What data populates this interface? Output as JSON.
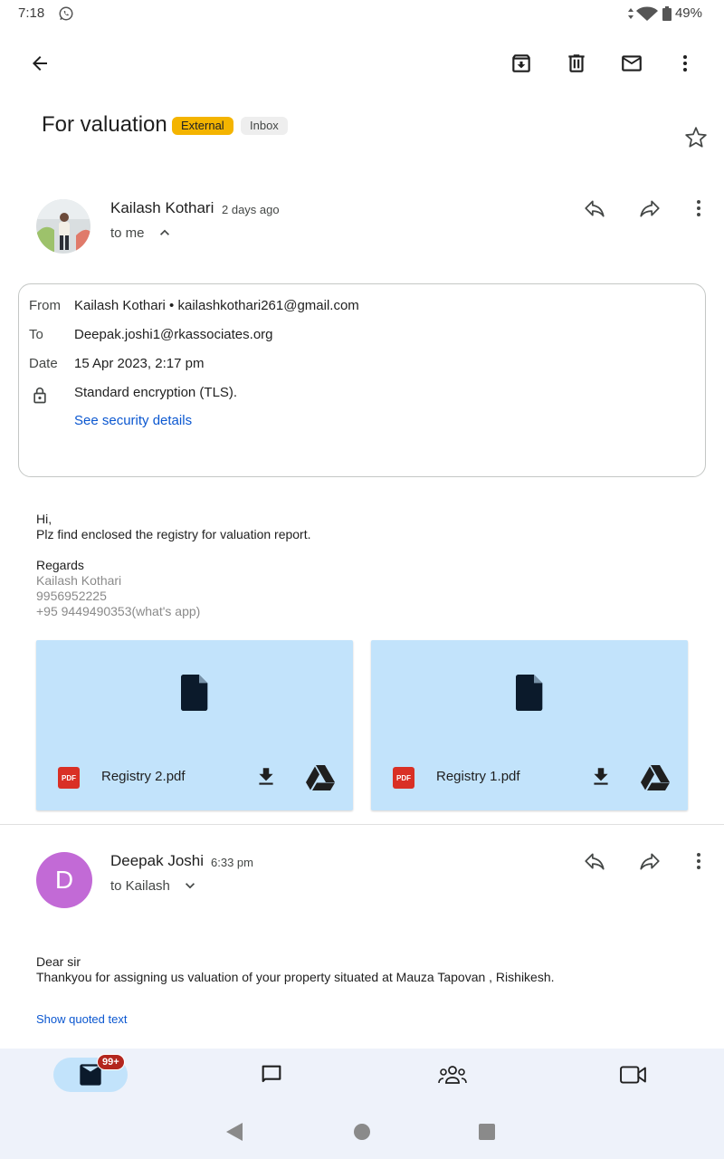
{
  "status_bar": {
    "time": "7:18",
    "battery": "49%"
  },
  "toolbar": {
    "back_icon": "arrow-left",
    "actions": [
      "archive-icon",
      "delete-icon",
      "mark-unread-icon",
      "more-vert-icon"
    ]
  },
  "subject": "For valuation",
  "labels": {
    "external": "External",
    "inbox": "Inbox"
  },
  "message1": {
    "sender": "Kailash Kothari",
    "time": "2 days ago",
    "to": "to me",
    "details": {
      "from_label": "From",
      "from_value": "Kailash Kothari • kailashkothari261@gmail.com",
      "to_label": "To",
      "to_value": "Deepak.joshi1@rkassociates.org",
      "date_label": "Date",
      "date_value": "15 Apr 2023, 2:17 pm",
      "encryption": "Standard encryption (TLS).",
      "security_link": "See security details"
    },
    "body": {
      "greeting": "Hi,",
      "line1": "Plz find enclosed the registry for valuation report.",
      "regards": "Regards",
      "sig_name": "Kailash Kothari",
      "sig_phone1": "9956952225",
      "sig_phone2": "+95 9449490353(what's app)"
    },
    "attachments": [
      {
        "name": "Registry 2.pdf",
        "type": "PDF"
      },
      {
        "name": "Registry 1.pdf",
        "type": "PDF"
      }
    ]
  },
  "message2": {
    "sender": "Deepak Joshi",
    "avatar_letter": "D",
    "time": "6:33 pm",
    "to": "to Kailash",
    "body": {
      "line1": "Dear sir",
      "line2": "Thankyou for assigning us valuation of your property situated at Mauza Tapovan , Rishikesh."
    },
    "show_quoted": "Show quoted text"
  },
  "bottom_nav": {
    "badge": "99+",
    "items": [
      "mail-icon",
      "chat-icon",
      "spaces-icon",
      "meet-icon"
    ]
  },
  "colors": {
    "accent": "#0b57d0",
    "external_chip": "#f4b400",
    "attachment_bg": "#c2e3fb",
    "avatar_d": "#c26ad6"
  }
}
